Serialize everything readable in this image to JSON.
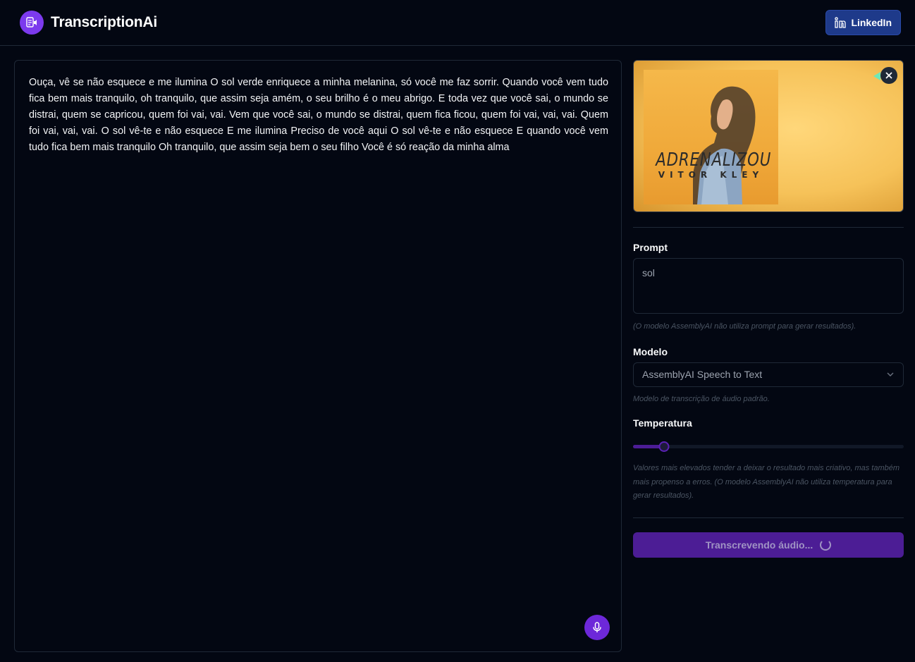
{
  "header": {
    "app_title": "TranscriptionAi",
    "linkedin_label": "LinkedIn"
  },
  "transcript": {
    "text": "Ouça, vê se não esquece e me ilumina O sol verde enriquece a minha melanina, só você me faz sorrir. Quando você vem tudo fica bem mais tranquilo, oh tranquilo, que assim seja amém, o seu brilho é o meu abrigo. E toda vez que você sai, o mundo se distrai, quem se capricou, quem foi vai, vai. Vem que você sai, o mundo se distrai, quem fica ficou, quem foi vai, vai, vai. Quem foi vai, vai, vai. O sol vê-te e não esquece E me ilumina Preciso de você aqui O sol vê-te e não esquece E quando você vem tudo fica bem mais tranquilo Oh tranquilo, que assim seja bem o seu filho Você é só reação da minha alma"
  },
  "video": {
    "cover_title": "ADRENALIZOU",
    "cover_artist": "VITOR KLEY"
  },
  "prompt": {
    "label": "Prompt",
    "value": "sol",
    "hint": "(O modelo AssemblyAI não utiliza prompt para gerar resultados)."
  },
  "model": {
    "label": "Modelo",
    "selected": "AssemblyAI Speech to Text",
    "hint": "Modelo de transcrição de áudio padrão."
  },
  "temperature": {
    "label": "Temperatura",
    "value_fraction": 0.115,
    "hint": "Valores mais elevados tender a deixar o resultado mais criativo, mas também mais propenso a erros. (O modelo AssemblyAI não utiliza temperatura para gerar resultados)."
  },
  "action": {
    "label": "Transcrevendo áudio..."
  },
  "colors": {
    "background": "#030712",
    "accent": "#7c3aed",
    "linkedin": "#1e3a8a",
    "border": "#1f2937"
  }
}
